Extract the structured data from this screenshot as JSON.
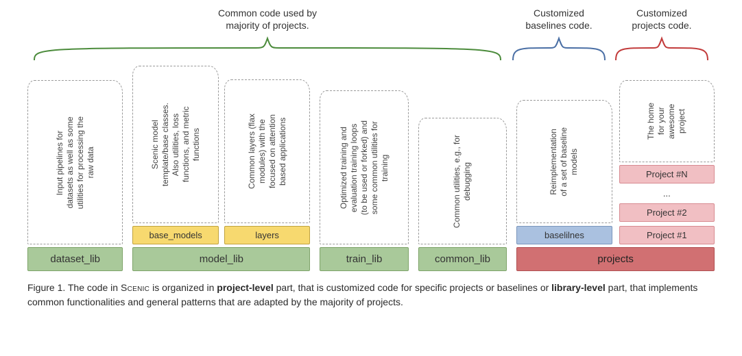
{
  "labels": {
    "common": "Common code used by\nmajority of projects.",
    "baselines": "Customized\nbaselines code.",
    "projects": "Customized\nprojects code."
  },
  "colors": {
    "green": "#4b8b3b",
    "blue": "#4a6fa5",
    "red": "#c23b3b"
  },
  "columns": {
    "dataset": {
      "desc": "Input pipelines for\ndatasets as well as some\nutilities for processing the\nraw data",
      "base": "dataset_lib"
    },
    "model": {
      "desc_base_models": "Scenic model\ntemplate/base classes.\nAlso utilities, loss\nfunctions, and metric\nfunctions",
      "desc_layers": "Common layers (flax\nmodules) with the\nfocused on attention\nbased applications",
      "sub_base_models": "base_models",
      "sub_layers": "layers",
      "base": "model_lib"
    },
    "train": {
      "desc": "Optimized training and\nevaluation training loops\n(to be used or forked) and\nsome common utilities for\ntraining",
      "base": "train_lib"
    },
    "common": {
      "desc": "Common utilities, e.g., for\ndebugging",
      "base": "common_lib"
    },
    "baselines": {
      "desc": "Reimplementation\nof a set of baseline\nmodels",
      "sub": "baselilnes"
    },
    "projects": {
      "desc_home": "The home\nfor your\nawesome\nproject",
      "p1": "Project #1",
      "p2": "Project #2",
      "pn": "Project #N",
      "ellipsis": "...",
      "base": "projects"
    }
  },
  "caption": {
    "prefix": "Figure 1. The code in ",
    "scenic": "Scenic",
    "mid1": " is organized in ",
    "bold1": "project-level",
    "mid2": " part, that is customized code for specific projects or baselines or ",
    "bold2": "library-level",
    "suffix": " part, that implements common functionalities and general patterns that are adapted by the majority of projects."
  }
}
